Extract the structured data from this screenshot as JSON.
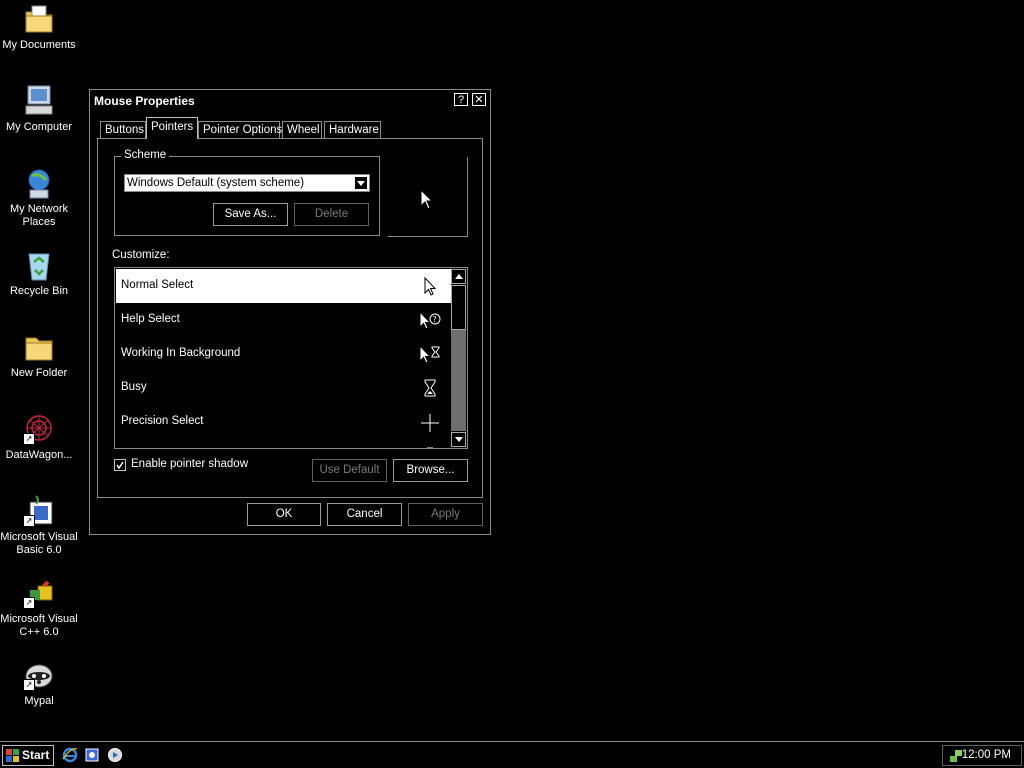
{
  "desktop_icons": [
    {
      "label": "My Documents",
      "icon": "folder-documents-icon"
    },
    {
      "label": "My Computer",
      "icon": "computer-icon"
    },
    {
      "label": "My Network Places",
      "icon": "network-icon"
    },
    {
      "label": "Recycle Bin",
      "icon": "recycle-bin-icon"
    },
    {
      "label": "New Folder",
      "icon": "folder-icon"
    },
    {
      "label": "DataWagon...",
      "icon": "datawagon-icon"
    },
    {
      "label": "Microsoft Visual Basic 6.0",
      "icon": "vb6-icon"
    },
    {
      "label": "Microsoft Visual C++ 6.0",
      "icon": "vcpp-icon"
    },
    {
      "label": "Mypal",
      "icon": "mypal-icon"
    }
  ],
  "dialog": {
    "title": "Mouse Properties",
    "help_button": "?",
    "close_button": "✕",
    "tabs": [
      {
        "label": "Buttons",
        "active": false
      },
      {
        "label": "Pointers",
        "active": true
      },
      {
        "label": "Pointer Options",
        "active": false
      },
      {
        "label": "Wheel",
        "active": false
      },
      {
        "label": "Hardware",
        "active": false
      }
    ],
    "scheme": {
      "legend": "Scheme",
      "selected": "Windows Default (system scheme)",
      "save_as": "Save As...",
      "delete": "Delete"
    },
    "customize_label": "Customize:",
    "pointer_list": [
      {
        "name": "Normal Select",
        "cursor": "arrow-cursor-icon",
        "selected": true
      },
      {
        "name": "Help Select",
        "cursor": "help-cursor-icon",
        "selected": false
      },
      {
        "name": "Working In Background",
        "cursor": "working-cursor-icon",
        "selected": false
      },
      {
        "name": "Busy",
        "cursor": "hourglass-cursor-icon",
        "selected": false
      },
      {
        "name": "Precision Select",
        "cursor": "crosshair-cursor-icon",
        "selected": false
      }
    ],
    "shadow_checkbox": {
      "label": "Enable pointer shadow",
      "checked": true
    },
    "use_default": "Use Default",
    "browse": "Browse...",
    "ok": "OK",
    "cancel": "Cancel",
    "apply": "Apply"
  },
  "taskbar": {
    "start_label": "Start",
    "quick_launch": [
      "ie-icon",
      "outlook-icon",
      "media-player-icon"
    ],
    "clock": "12:00 PM"
  },
  "colors": {
    "background": "#000000",
    "foreground": "#ffffff",
    "border": "#8a8a8a",
    "disabled": "#7a7a7a"
  }
}
